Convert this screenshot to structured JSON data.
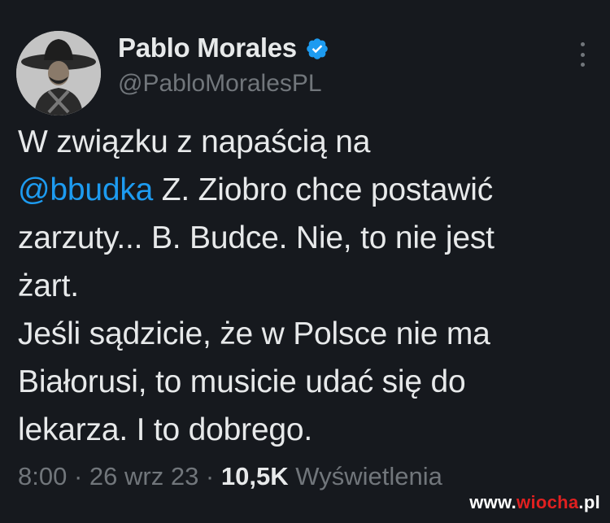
{
  "author": {
    "display_name": "Pablo Morales",
    "handle": "@PabloMoralesPL",
    "verified": true,
    "avatar": "avatar-man-sombrero"
  },
  "tweet": {
    "lines": [
      {
        "text": "W związku z napaścią na"
      },
      {
        "mention": "@bbudka",
        "text": " Z. Ziobro chce postawić"
      },
      {
        "text": "zarzuty... B. Budce. Nie, to nie jest"
      },
      {
        "text": "żart."
      },
      {
        "text": "Jeśli sądzicie, że w Polsce nie ma"
      },
      {
        "text": "Białorusi, to musicie udać się do"
      },
      {
        "text": "lekarza. I to dobrego."
      }
    ]
  },
  "meta": {
    "time": "8:00",
    "sep1": " · ",
    "date": "26 wrz 23",
    "sep2": " · ",
    "views_count": "10,5K",
    "views_label": " Wyświetlenia"
  },
  "watermark": {
    "prefix": "www.",
    "accent": "wiocha",
    "suffix": ".pl"
  },
  "colors": {
    "background": "#16191e",
    "text": "#e7e9ea",
    "muted": "#71767b",
    "mention": "#1d9bf0",
    "verified": "#1d9bf0"
  },
  "icons": {
    "verified": "verified-badge-icon",
    "more": "more-options-icon"
  }
}
